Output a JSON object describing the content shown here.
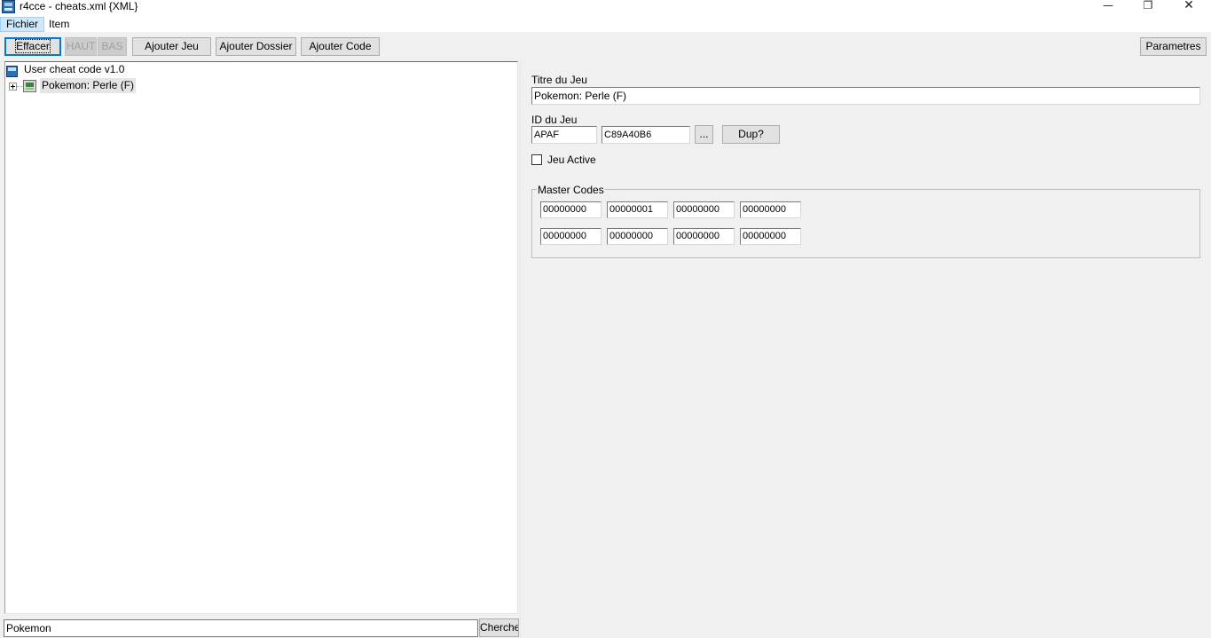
{
  "window": {
    "title": "r4cce - cheats.xml {XML}",
    "minimize_glyph": "—",
    "maximize_glyph": "❐",
    "close_glyph": "✕"
  },
  "menu": {
    "items": [
      "Fichier",
      "Item"
    ]
  },
  "toolbar": {
    "effacer": "Effacer",
    "haut": "HAUT",
    "bas": "BAS",
    "ajouter_jeu": "Ajouter Jeu",
    "ajouter_dossier": "Ajouter Dossier",
    "ajouter_code": "Ajouter Code",
    "parametres": "Parametres"
  },
  "tree": {
    "root_label": "User cheat code v1.0",
    "game_label": "Pokemon: Perle (F)"
  },
  "search": {
    "value": "Pokemon",
    "button_label": "Cherche"
  },
  "details": {
    "titre_label": "Titre du Jeu",
    "titre_value": "Pokemon: Perle (F)",
    "id_label": "ID du Jeu",
    "id_value": "APAF",
    "crc_value": "C89A40B6",
    "browse_label": "...",
    "dup_label": "Dup?",
    "active_label": "Jeu Active",
    "active_checked": false,
    "master_codes_label": "Master Codes",
    "master_codes": [
      [
        "00000000",
        "00000001",
        "00000000",
        "00000000"
      ],
      [
        "00000000",
        "00000000",
        "00000000",
        "00000000"
      ]
    ]
  },
  "colors": {
    "accent_focus": "#0078d7",
    "menu_highlight": "#cce8ff",
    "window_bg": "#f0f0f0"
  }
}
